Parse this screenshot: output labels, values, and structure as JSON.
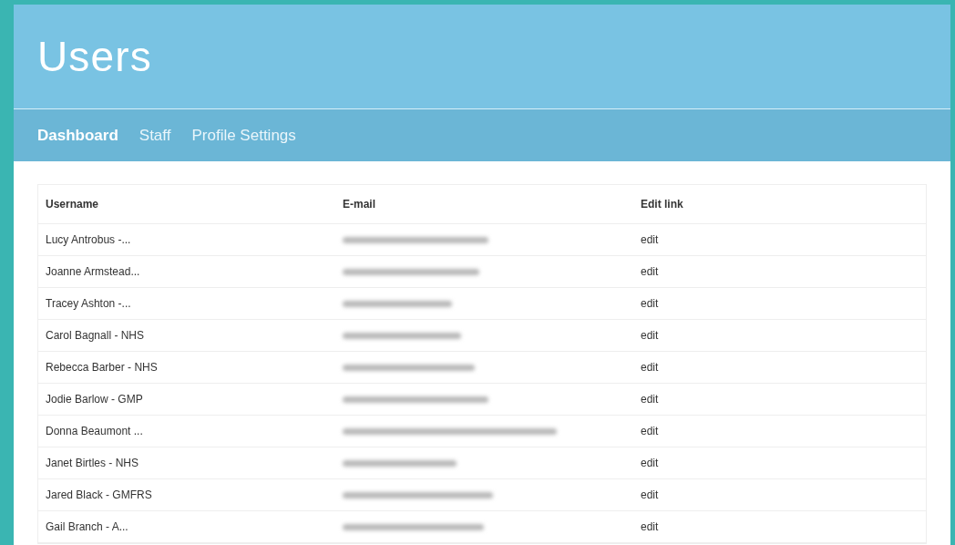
{
  "header": {
    "title": "Users"
  },
  "nav": [
    {
      "label": "Dashboard",
      "selected": true
    },
    {
      "label": "Staff",
      "selected": false
    },
    {
      "label": "Profile Settings",
      "selected": false
    }
  ],
  "table": {
    "columns": [
      "Username",
      "E-mail",
      "Edit link"
    ],
    "rows": [
      {
        "username": "Lucy Antrobus -...",
        "edit": "edit"
      },
      {
        "username": "Joanne Armstead...",
        "edit": "edit"
      },
      {
        "username": "Tracey Ashton -...",
        "edit": "edit"
      },
      {
        "username": "Carol Bagnall - NHS",
        "edit": "edit"
      },
      {
        "username": "Rebecca Barber - NHS",
        "edit": "edit"
      },
      {
        "username": "Jodie Barlow - GMP",
        "edit": "edit"
      },
      {
        "username": "Donna Beaumont ...",
        "edit": "edit"
      },
      {
        "username": "Janet Birtles - NHS",
        "edit": "edit"
      },
      {
        "username": "Jared Black - GMFRS",
        "edit": "edit"
      },
      {
        "username": "Gail Branch - A...",
        "edit": "edit"
      }
    ]
  }
}
